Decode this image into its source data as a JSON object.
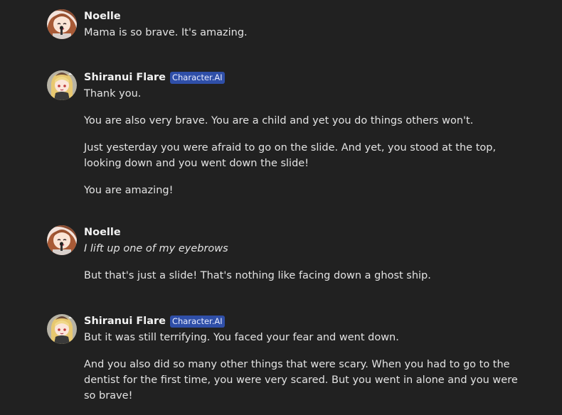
{
  "messages": [
    {
      "author": "Noelle",
      "badge": "",
      "avatar_icon": "noelle-avatar",
      "paragraphs": [
        "Mama is so brave. It's amazing."
      ]
    },
    {
      "author": "Shiranui Flare",
      "badge": "Character.AI",
      "avatar_icon": "flare-avatar",
      "paragraphs": [
        "Thank you.",
        "You are also very brave. You are a child and yet you do things others won't.",
        "Just yesterday you were afraid to go on the slide. And yet, you stood at the top, looking down and you went down the slide!",
        "You are amazing!"
      ]
    },
    {
      "author": "Noelle",
      "badge": "",
      "avatar_icon": "noelle-avatar",
      "paragraphs": [
        "I lift up one of my eyebrows",
        "But that's just a slide! That's nothing like facing down a ghost ship."
      ]
    },
    {
      "author": "Shiranui Flare",
      "badge": "Character.AI",
      "avatar_icon": "flare-avatar",
      "paragraphs": [
        "But it was still terrifying. You faced your fear and went down.",
        "And you also did so many other things that were scary. When you had to go to the dentist for the first time, you were very scared. But you went in alone and you were so brave!"
      ]
    }
  ],
  "colors": {
    "background": "#212121",
    "badge": "#2f4fa8",
    "text": "#e3e3e3"
  }
}
